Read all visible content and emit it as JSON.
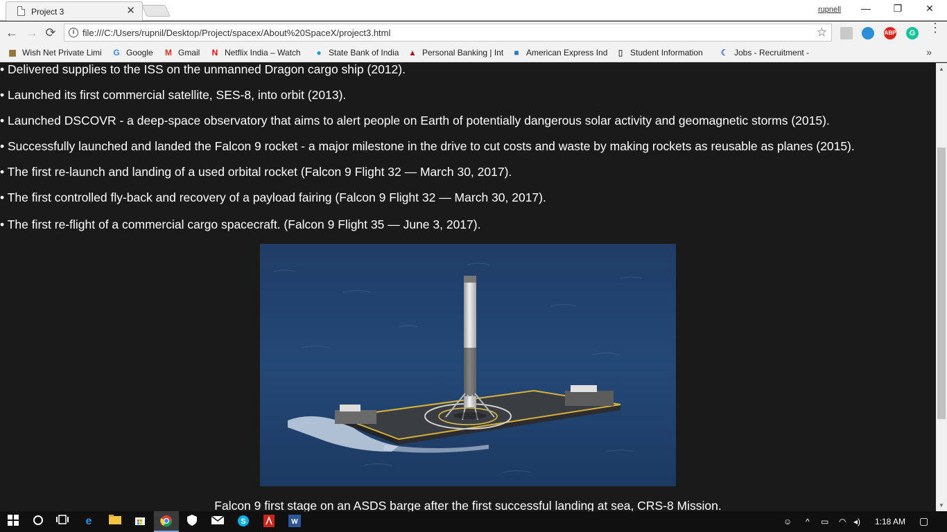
{
  "browser": {
    "tab_title": "Project 3",
    "tab_close": "✕",
    "profile_name": "rupnell",
    "window_controls": {
      "minimize": "—",
      "restore": "❐",
      "close": "✕"
    },
    "nav": {
      "back": "←",
      "forward": "→",
      "reload": "⟳"
    },
    "url": "file:///C:/Users/rupnil/Desktop/Project/spacex/About%20SpaceX/project3.html",
    "bookmark_star": "☆",
    "extensions": [
      {
        "name": "extension-icon",
        "color": "#c9c9c9"
      },
      {
        "name": "eye-extension-icon",
        "color": "#2a8fd6"
      },
      {
        "name": "adblock-plus-icon",
        "color": "#d9261c",
        "label": "ABP"
      },
      {
        "name": "grammarly-icon",
        "color": "#15c39a",
        "label": "G"
      }
    ],
    "menu": "⋮"
  },
  "bookmarks": {
    "items": [
      {
        "label": "Wish Net Private Limi",
        "icon": "wishnet-icon",
        "glyph": "▦",
        "color": "#8a6a2a"
      },
      {
        "label": "Google",
        "icon": "google-icon",
        "glyph": "G",
        "color": "#4285f4"
      },
      {
        "label": "Gmail",
        "icon": "gmail-icon",
        "glyph": "M",
        "color": "#d93025"
      },
      {
        "label": "Netflix India – Watch",
        "icon": "netflix-icon",
        "glyph": "N",
        "color": "#e50914"
      },
      {
        "label": "State Bank of India",
        "icon": "sbi-icon",
        "glyph": "●",
        "color": "#1a9ad6"
      },
      {
        "label": "Personal Banking | Int",
        "icon": "bank-icon",
        "glyph": "▲",
        "color": "#a51e22"
      },
      {
        "label": "American Express Ind",
        "icon": "amex-icon",
        "glyph": "■",
        "color": "#2e77bb"
      },
      {
        "label": "Student Information",
        "icon": "page-icon",
        "glyph": "▯",
        "color": "#555555"
      },
      {
        "label": "Jobs - Recruitment -",
        "icon": "jobs-icon",
        "glyph": "☾",
        "color": "#3d6fb5"
      }
    ],
    "more": "»"
  },
  "content": {
    "facts": [
      "• Delivered supplies to the ISS on the unmanned Dragon cargo ship (2012).",
      "• Launched its first commercial satellite, SES-8, into orbit (2013).",
      "• Launched DSCOVR - a deep-space observatory that aims to alert people on Earth of potentially dangerous solar activity and geomagnetic storms (2015).",
      "• Successfully launched and landed the Falcon 9 rocket - a major milestone in the drive to cut costs and waste by making rockets as reusable as planes (2015).",
      "• The first re-launch and landing of a used orbital rocket (Falcon 9 Flight 32 — March 30, 2017).",
      "• The first controlled fly-back and recovery of a payload fairing (Falcon 9 Flight 32 — March 30, 2017).",
      "• The first re-flight of a commercial cargo spacecraft. (Falcon 9 Flight 35 — June 3, 2017)."
    ],
    "figure_caption": "Falcon 9 first stage on an ASDS barge after the first successful landing at sea, CRS-8 Mission."
  },
  "scrollbar": {
    "up": "▲",
    "down": "▼"
  },
  "taskbar": {
    "clock": "1:18 AM",
    "tray_glyphs": {
      "people": "☺",
      "chevron": "^",
      "battery": "▭",
      "wifi": "◠",
      "volume": "◂)"
    },
    "notification": "▢"
  }
}
